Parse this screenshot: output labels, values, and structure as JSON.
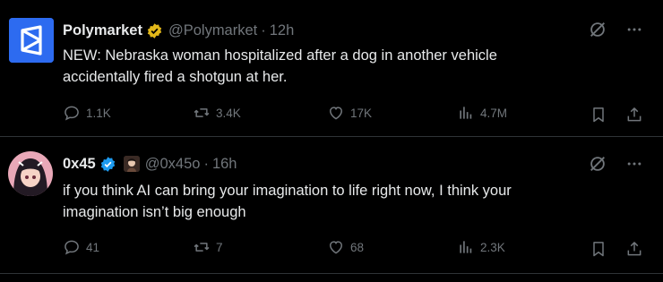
{
  "tweets": [
    {
      "name": "Polymarket",
      "handle": "@Polymarket",
      "separator": "·",
      "time": "12h",
      "badge": "gold-verified-badge",
      "text_line1": "NEW: Nebraska woman hospitalized after a dog in another vehicle",
      "text_line2": "accidentally fired a shotgun at her.",
      "replies": "1.1K",
      "retweets": "3.4K",
      "likes": "17K",
      "views": "4.7M"
    },
    {
      "name": "0x45",
      "handle": "@0x45o",
      "separator": "·",
      "time": "16h",
      "badge": "blue-verified-badge",
      "text_line1": "if you think AI can bring your imagination to life right now, I think your",
      "text_line2": "imagination isn’t big enough",
      "replies": "41",
      "retweets": "7",
      "likes": "68",
      "views": "2.3K"
    }
  ],
  "colors": {
    "background": "#000000",
    "text": "#e7e9ea",
    "muted": "#71767b",
    "divider": "#2f3336",
    "gold": "#e2b719",
    "blue": "#1d9bf0",
    "polymarket": "#2d6bf0"
  },
  "icons": [
    "grok-icon",
    "more-icon",
    "reply-icon",
    "retweet-icon",
    "like-icon",
    "views-icon",
    "bookmark-icon",
    "share-icon"
  ]
}
